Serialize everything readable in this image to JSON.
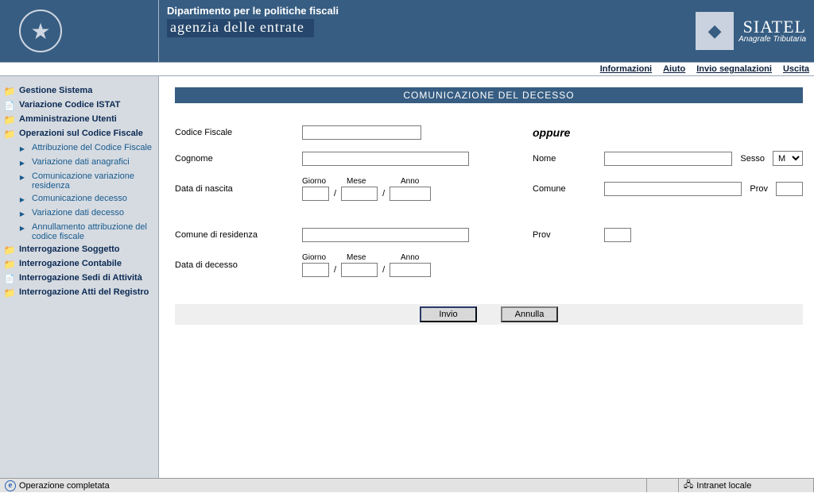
{
  "header": {
    "department": "Dipartimento per le politiche fiscali",
    "agency": "agenzia delle entrate",
    "brand_title": "SIATEL",
    "brand_subtitle": "Anagrafe Tributaria"
  },
  "top_links": {
    "info": "Informazioni",
    "help": "Aiuto",
    "report": "Invio segnalazioni",
    "exit": "Uscita"
  },
  "sidebar": [
    {
      "label": "Gestione Sistema",
      "level": 0,
      "icon": "folder"
    },
    {
      "label": "Variazione Codice ISTAT",
      "level": 0,
      "icon": "page"
    },
    {
      "label": "Amministrazione Utenti",
      "level": 0,
      "icon": "folder"
    },
    {
      "label": "Operazioni sul Codice Fiscale",
      "level": 0,
      "icon": "folder",
      "selected": true
    },
    {
      "label": "Attribuzione del Codice Fiscale",
      "level": 1,
      "icon": "page"
    },
    {
      "label": "Variazione dati anagrafici",
      "level": 1,
      "icon": "page"
    },
    {
      "label": "Comunicazione variazione residenza",
      "level": 1,
      "icon": "page"
    },
    {
      "label": "Comunicazione decesso",
      "level": 1,
      "icon": "page"
    },
    {
      "label": "Variazione dati decesso",
      "level": 1,
      "icon": "page"
    },
    {
      "label": "Annullamento attribuzione del codice fiscale",
      "level": 1,
      "icon": "page"
    },
    {
      "label": "Interrogazione Soggetto",
      "level": 0,
      "icon": "folder"
    },
    {
      "label": "Interrogazione Contabile",
      "level": 0,
      "icon": "folder"
    },
    {
      "label": "Interrogazione Sedi di Attività",
      "level": 0,
      "icon": "page"
    },
    {
      "label": "Interrogazione Atti del Registro",
      "level": 0,
      "icon": "folder"
    }
  ],
  "panel": {
    "title": "COMUNICAZIONE DEL DECESSO",
    "labels": {
      "cf": "Codice Fiscale",
      "cognome": "Cognome",
      "data_nascita": "Data di nascita",
      "comune_res": "Comune di residenza",
      "data_decesso": "Data di decesso",
      "oppure": "oppure",
      "nome": "Nome",
      "sesso": "Sesso",
      "comune": "Comune",
      "prov": "Prov",
      "giorno": "Giorno",
      "mese": "Mese",
      "anno": "Anno"
    },
    "sesso_value": "M",
    "buttons": {
      "submit": "Invio",
      "cancel": "Annulla"
    }
  },
  "status": {
    "completed": "Operazione completata",
    "zone": "Intranet locale"
  }
}
